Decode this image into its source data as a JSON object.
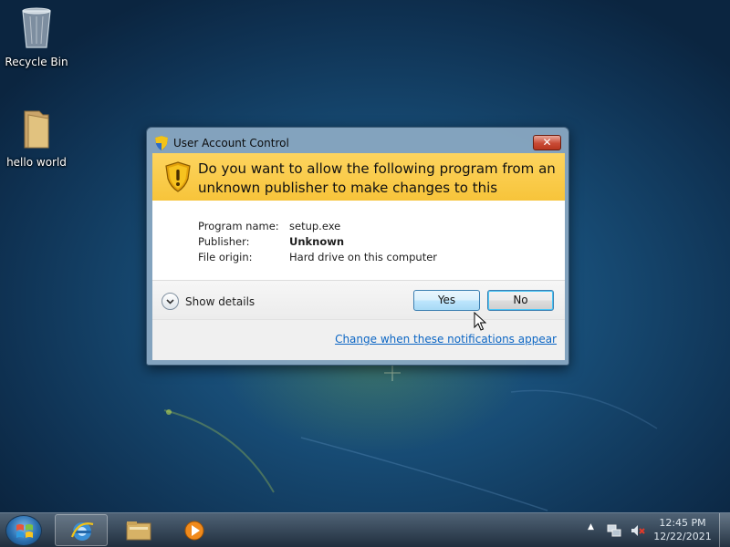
{
  "desktop": {
    "icons": [
      {
        "label": "Recycle Bin",
        "icon": "recycle-bin-icon"
      },
      {
        "label": "hello world",
        "icon": "folder-icon"
      }
    ]
  },
  "dialog": {
    "title": "User Account Control",
    "close_label": "✕",
    "question": "Do you want to allow the following program from an unknown publisher to make changes to this computer?",
    "fields": {
      "program_label": "Program name:",
      "program_value": "setup.exe",
      "publisher_label": "Publisher:",
      "publisher_value": "Unknown",
      "origin_label": "File origin:",
      "origin_value": "Hard drive on this computer"
    },
    "show_details_label": "Show details",
    "yes_label": "Yes",
    "no_label": "No",
    "change_link": "Change when these notifications appear",
    "colors": {
      "banner": "#f7c43a",
      "link": "#0c66c4"
    }
  },
  "taskbar": {
    "pinned": [
      {
        "name": "internet-explorer",
        "icon": "internet-explorer-icon",
        "active": true
      },
      {
        "name": "windows-explorer",
        "icon": "folder-icon",
        "active": false
      },
      {
        "name": "media-player",
        "icon": "media-player-icon",
        "active": false
      }
    ],
    "tray": {
      "overflow_glyph": "▲",
      "network_icon": "network-icon",
      "volume_icon": "volume-muted-icon"
    },
    "clock": {
      "time": "12:45 PM",
      "date": "12/22/2021"
    }
  }
}
